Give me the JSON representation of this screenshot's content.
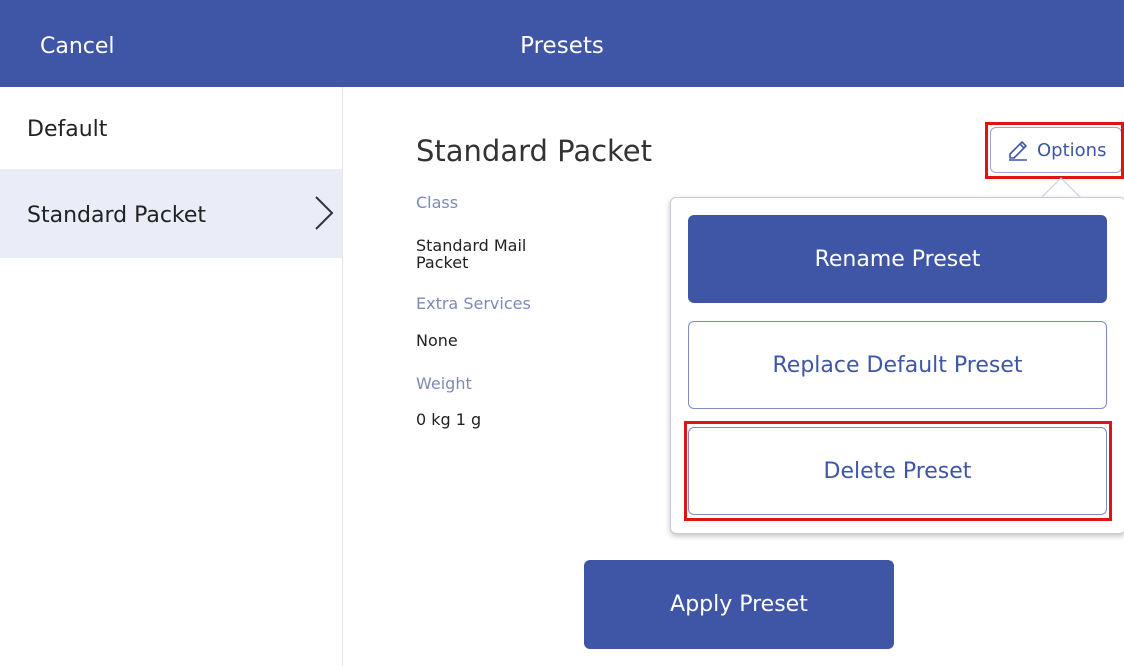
{
  "header": {
    "cancel_label": "Cancel",
    "title": "Presets"
  },
  "sidebar": {
    "items": [
      {
        "label": "Default"
      },
      {
        "label": "Standard Packet"
      }
    ]
  },
  "detail": {
    "title": "Standard Packet",
    "class_label": "Class",
    "class_value_line1": "Standard Mail",
    "class_value_line2": "Packet",
    "extra_label": "Extra Services",
    "extra_value": "None",
    "weight_label": "Weight",
    "weight_value": "0 kg 1 g"
  },
  "options": {
    "label": "Options",
    "icon": "pencil-icon"
  },
  "menu": {
    "rename_label": "Rename Preset",
    "replace_label": "Replace Default Preset",
    "delete_label": "Delete Preset"
  },
  "apply_label": "Apply Preset",
  "colors": {
    "primary": "#3f55a5",
    "highlight_red": "#e01414",
    "selected_row": "#eaecf7",
    "label_blue": "#7d8ab8"
  }
}
